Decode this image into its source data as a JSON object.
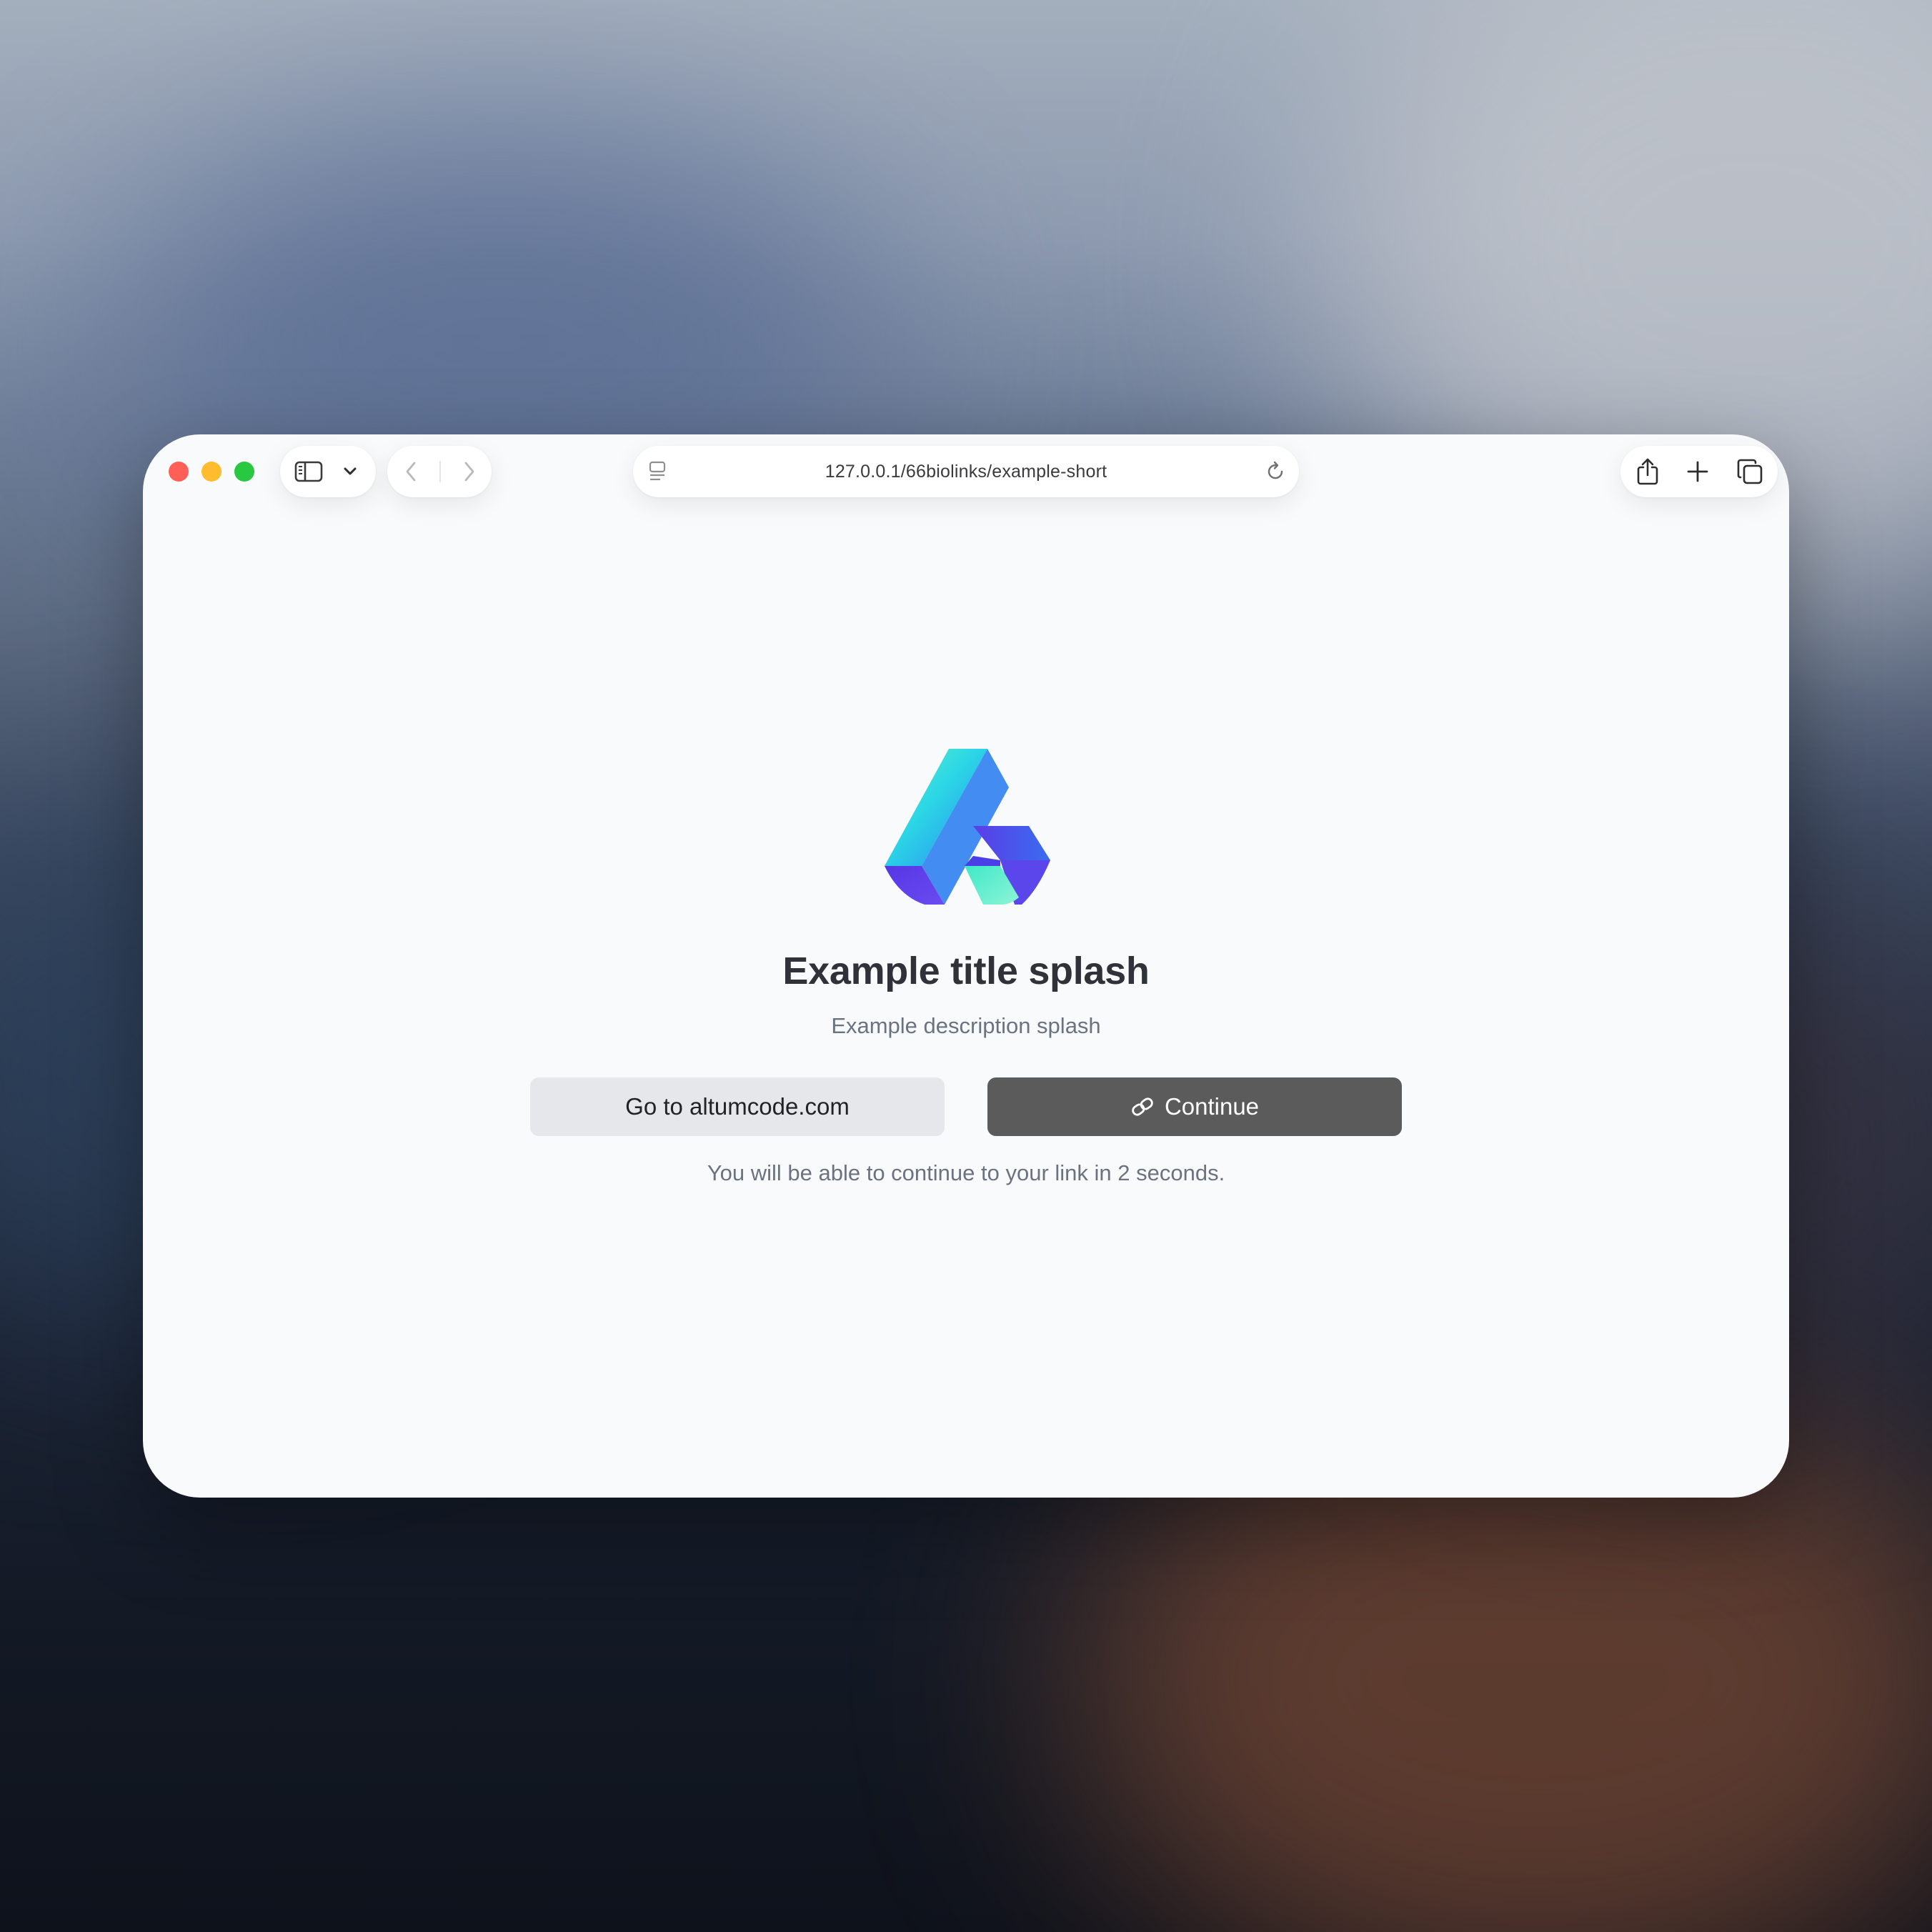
{
  "browser": {
    "url": "127.0.0.1/66biolinks/example-short",
    "traffic_lights": {
      "close": "#ff5f57",
      "minimize": "#febc2e",
      "zoom": "#28c840"
    },
    "icons": {
      "sidebar": "sidebar-icon",
      "sidebar_menu": "chevron-down-icon",
      "back": "chevron-left-icon",
      "forward": "chevron-right-icon",
      "reader": "reader-icon",
      "reload": "reload-icon",
      "share": "share-icon",
      "new_tab": "plus-icon",
      "tabs": "tab-overview-icon"
    }
  },
  "splash": {
    "title": "Example title splash",
    "description": "Example description splash",
    "secondary_button_label": "Go to altumcode.com",
    "primary_button_label": "Continue",
    "primary_button_icon": "link-icon",
    "countdown_text": "You will be able to continue to your link in 2 seconds.",
    "colors": {
      "background": "#f9fafb",
      "primary_button": "#5b5b5c",
      "secondary_button": "#e6e7ea",
      "logo_gradient_start": "#4ef0c8",
      "logo_gradient_end": "#5b3de6"
    }
  }
}
